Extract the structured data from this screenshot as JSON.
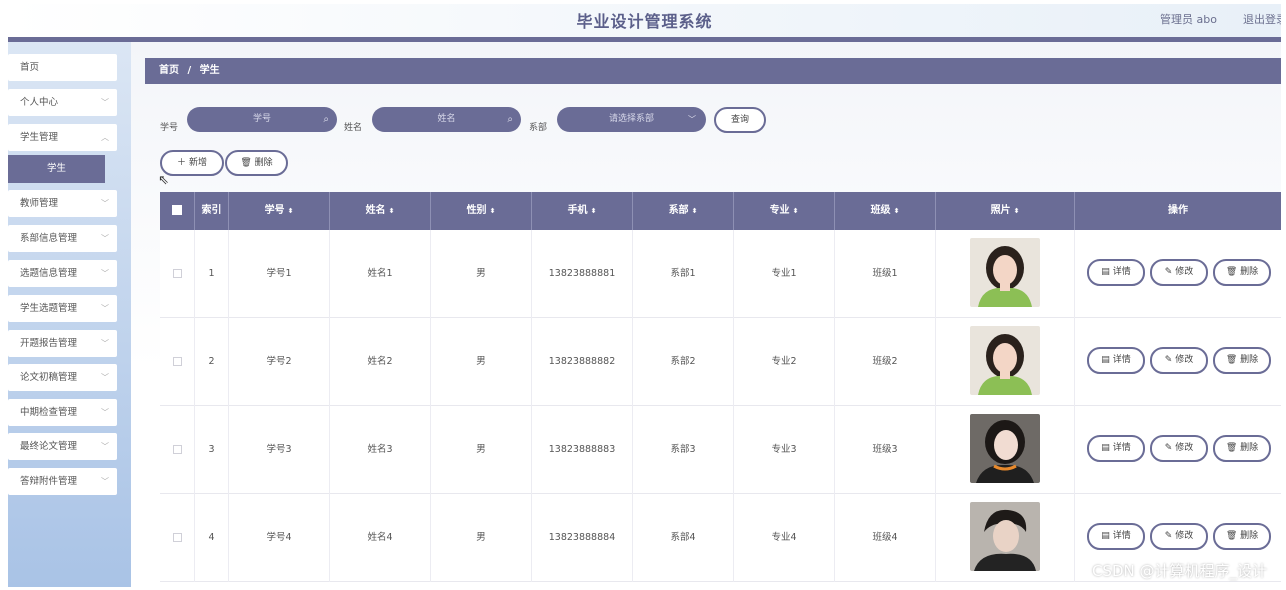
{
  "header": {
    "title": "毕业设计管理系统",
    "user": "管理员 abo",
    "logout": "退出登录"
  },
  "sidebar": {
    "items": [
      {
        "label": "首页",
        "has_chevron": false
      },
      {
        "label": "个人中心",
        "has_chevron": true
      },
      {
        "label": "学生管理",
        "has_chevron": true
      },
      {
        "label": "教师管理",
        "has_chevron": true
      },
      {
        "label": "系部信息管理",
        "has_chevron": true
      },
      {
        "label": "选题信息管理",
        "has_chevron": true
      },
      {
        "label": "学生选题管理",
        "has_chevron": true
      },
      {
        "label": "开题报告管理",
        "has_chevron": true
      },
      {
        "label": "论文初稿管理",
        "has_chevron": true
      },
      {
        "label": "中期检查管理",
        "has_chevron": true
      },
      {
        "label": "最终论文管理",
        "has_chevron": true
      },
      {
        "label": "答辩附件管理",
        "has_chevron": true
      }
    ],
    "active_sub": "学生"
  },
  "breadcrumb": {
    "home": "首页",
    "sep": "/",
    "current": "学生"
  },
  "search": {
    "student_no_label": "学号",
    "student_no_placeholder": "学号",
    "name_label": "姓名",
    "name_placeholder": "姓名",
    "dept_label": "系部",
    "dept_placeholder": "请选择系部",
    "query_button": "查询"
  },
  "actions": {
    "add": "新增",
    "delete": "删除"
  },
  "table": {
    "headers": [
      "索引",
      "学号",
      "姓名",
      "性别",
      "手机",
      "系部",
      "专业",
      "班级",
      "照片",
      "操作"
    ],
    "rows": [
      {
        "index": "1",
        "student_no": "学号1",
        "name": "姓名1",
        "gender": "男",
        "phone": "13823888881",
        "dept": "系部1",
        "major": "专业1",
        "class": "班级1"
      },
      {
        "index": "2",
        "student_no": "学号2",
        "name": "姓名2",
        "gender": "男",
        "phone": "13823888882",
        "dept": "系部2",
        "major": "专业2",
        "class": "班级2"
      },
      {
        "index": "3",
        "student_no": "学号3",
        "name": "姓名3",
        "gender": "男",
        "phone": "13823888883",
        "dept": "系部3",
        "major": "专业3",
        "class": "班级3"
      },
      {
        "index": "4",
        "student_no": "学号4",
        "name": "姓名4",
        "gender": "男",
        "phone": "13823888884",
        "dept": "系部4",
        "major": "专业4",
        "class": "班级4"
      }
    ],
    "row_actions": {
      "detail": "详情",
      "edit": "修改",
      "delete": "删除"
    }
  },
  "watermark": "CSDN @计算机程序_设计",
  "colors": {
    "accent": "#6a6c96",
    "sidebar_top": "#dbe6f4",
    "sidebar_bottom": "#a9c3e6"
  }
}
